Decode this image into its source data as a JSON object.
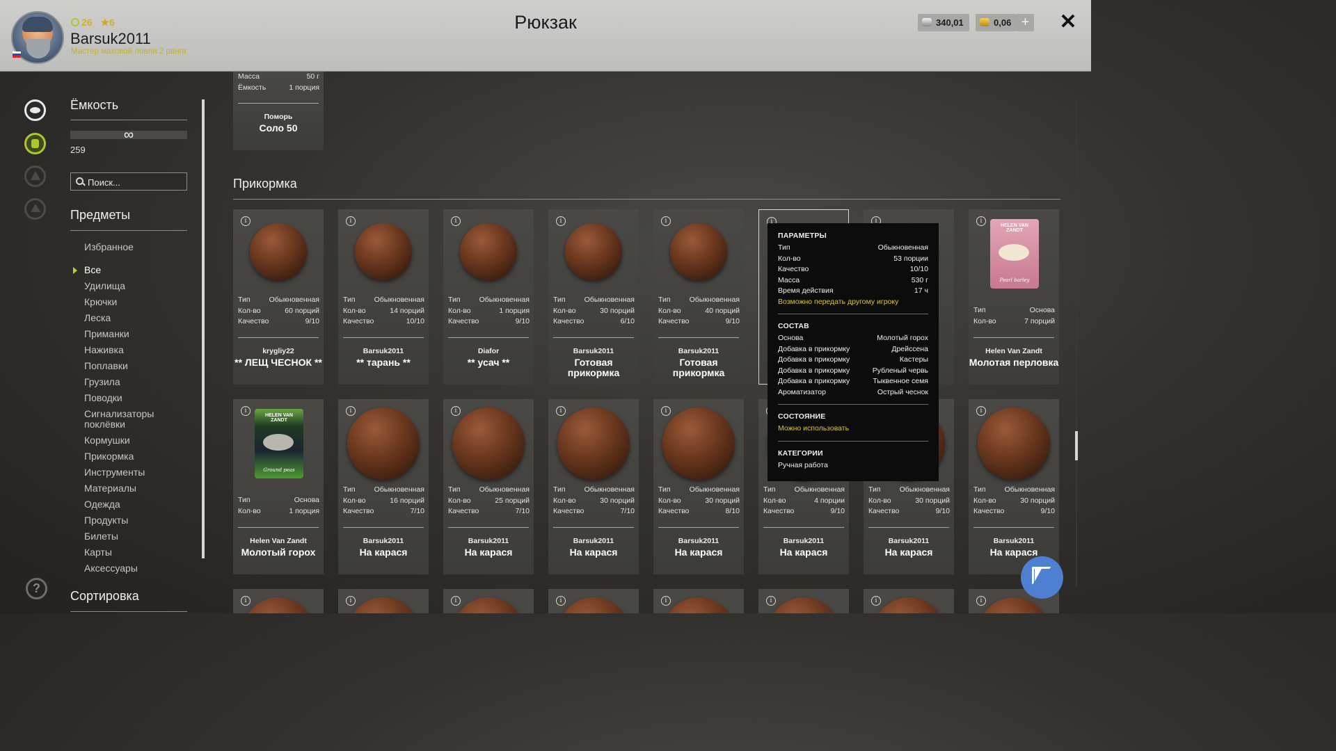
{
  "header": {
    "level": "26",
    "stars": "6",
    "username": "Barsuk2011",
    "rank": "Мастер маховой ловли 2 ранга",
    "title": "Рюкзак",
    "silver": "340,01",
    "gold": "0,06",
    "plus": "+",
    "close": "✕"
  },
  "sidebar": {
    "capacity_title": "Ёмкость",
    "capacity_symbol": "∞",
    "capacity_value": "259",
    "search_placeholder": "Поиск...",
    "items_title": "Предметы",
    "favorites": "Избранное",
    "categories": [
      "Все",
      "Удилища",
      "Крючки",
      "Леска",
      "Приманки",
      "Наживка",
      "Поплавки",
      "Грузила",
      "Поводки",
      "Сигнализаторы поклёвки",
      "Кормушки",
      "Прикормка",
      "Инструменты",
      "Материалы",
      "Одежда",
      "Продукты",
      "Билеты",
      "Карты",
      "Аксессуары"
    ],
    "active_category": "Все",
    "sorting_title": "Сортировка"
  },
  "top_card": {
    "props": [
      [
        "Масса",
        "50 г"
      ],
      [
        "Ёмкость",
        "1 порция"
      ]
    ],
    "author": "Поморь",
    "name": "Соло 50"
  },
  "section": {
    "title": "Прикормка"
  },
  "labels": {
    "type": "Тип",
    "qty": "Кол-во",
    "quality": "Качество",
    "info": "i"
  },
  "row1": [
    {
      "type": "Обыкновенная",
      "qty": "60 порций",
      "quality": "9/10",
      "author": "krygliy22",
      "name": "** ЛЕЩ ЧЕСНОК **"
    },
    {
      "type": "Обыкновенная",
      "qty": "14 порций",
      "quality": "10/10",
      "author": "Barsuk2011",
      "name": "** тарань **"
    },
    {
      "type": "Обыкновенная",
      "qty": "1 порция",
      "quality": "9/10",
      "author": "Diafor",
      "name": "** усач **"
    },
    {
      "type": "Обыкновенная",
      "qty": "30 порций",
      "quality": "6/10",
      "author": "Barsuk2011",
      "name": "Готовая прикормка"
    },
    {
      "type": "Обыкновенная",
      "qty": "40 порций",
      "quality": "9/10",
      "author": "Barsuk2011",
      "name": "Готовая прикормка"
    },
    {
      "type": "",
      "qty": "",
      "quality": "",
      "author": "",
      "name": ""
    },
    {
      "type": "",
      "qty": "",
      "quality": "",
      "author": "",
      "name": ""
    },
    {
      "type": "Основа",
      "qty": "7 порций",
      "quality": "",
      "author": "Helen Van Zandt",
      "name": "Молотая перловка",
      "pack_brand": "HELEN VAN ZANDT",
      "pack_name": "Pearl barley"
    }
  ],
  "row2": [
    {
      "type": "Основа",
      "qty": "1 порция",
      "quality": "",
      "author": "Helen Van Zandt",
      "name": "Молотый горох",
      "pack_brand": "HELEN VAN ZANDT",
      "pack_name": "Ground peas"
    },
    {
      "type": "Обыкновенная",
      "qty": "16 порций",
      "quality": "7/10",
      "author": "Barsuk2011",
      "name": "На карася"
    },
    {
      "type": "Обыкновенная",
      "qty": "25 порций",
      "quality": "7/10",
      "author": "Barsuk2011",
      "name": "На карася"
    },
    {
      "type": "Обыкновенная",
      "qty": "30 порций",
      "quality": "7/10",
      "author": "Barsuk2011",
      "name": "На карася"
    },
    {
      "type": "Обыкновенная",
      "qty": "30 порций",
      "quality": "8/10",
      "author": "Barsuk2011",
      "name": "На карася"
    },
    {
      "type": "Обыкновенная",
      "qty": "4 порции",
      "quality": "9/10",
      "author": "Barsuk2011",
      "name": "На карася"
    },
    {
      "type": "Обыкновенная",
      "qty": "30 порций",
      "quality": "9/10",
      "author": "Barsuk2011",
      "name": "На карася"
    },
    {
      "type": "Обыкновенная",
      "qty": "30 порций",
      "quality": "9/10",
      "author": "Barsuk2011",
      "name": "На карася"
    }
  ],
  "tooltip": {
    "params_title": "ПАРАМЕТРЫ",
    "params": [
      [
        "Тип",
        "Обыкновенная"
      ],
      [
        "Кол-во",
        "53 порции"
      ],
      [
        "Качество",
        "10/10"
      ],
      [
        "Масса",
        "530 г"
      ],
      [
        "Время действия",
        "17 ч"
      ]
    ],
    "transfer": "Возможно передать другому игроку",
    "composition_title": "СОСТАВ",
    "composition": [
      [
        "Основа",
        "Молотый горох"
      ],
      [
        "Добавка в прикормку",
        "Дрейссена"
      ],
      [
        "Добавка в прикормку",
        "Кастеры"
      ],
      [
        "Добавка в прикормку",
        "Рубленый червь"
      ],
      [
        "Добавка в прикормку",
        "Тыквенное семя"
      ],
      [
        "Ароматизатор",
        "Острый чеснок"
      ]
    ],
    "state_title": "СОСТОЯНИЕ",
    "state": "Можно использовать",
    "categories_title": "КАТЕГОРИИ",
    "category": "Ручная работа"
  },
  "colors": {
    "accent": "#c9b430",
    "selected_icon": "#aac82d",
    "tooltip_bg": "#0c0c0c",
    "cursor_button": "#4f7fd0"
  },
  "icons": {
    "rail": [
      "fish-icon",
      "backpack-icon",
      "tent-icon",
      "home-icon"
    ],
    "help": "?"
  }
}
